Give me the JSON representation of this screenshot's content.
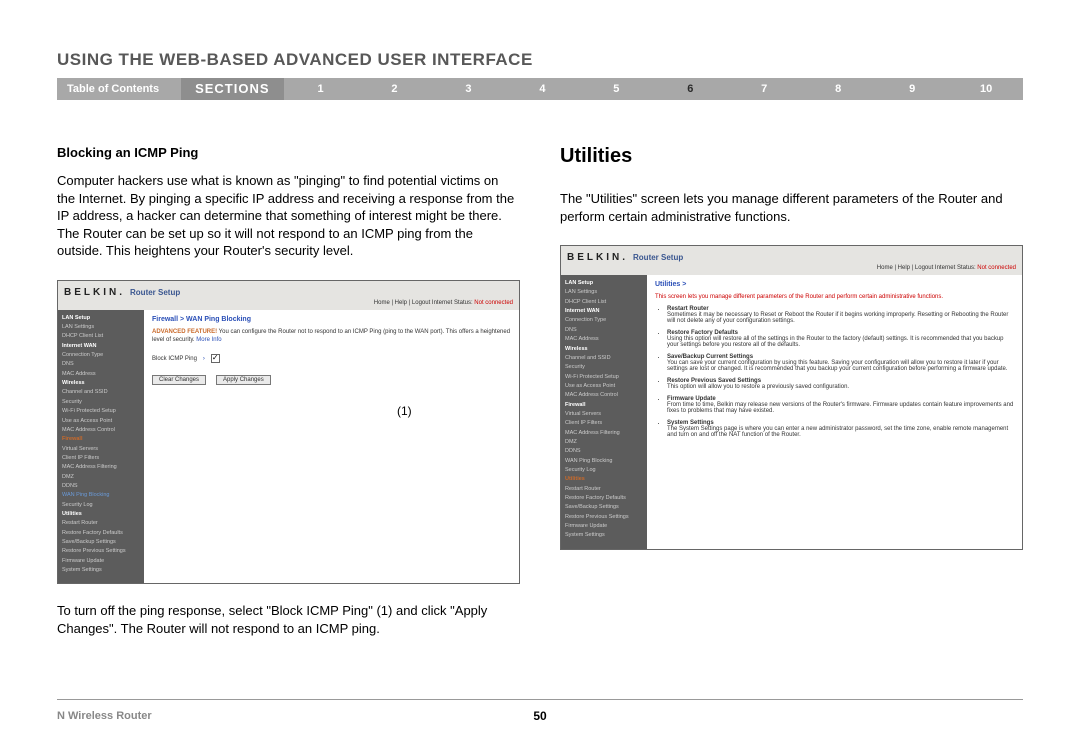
{
  "page": {
    "title": "USING THE WEB-BASED ADVANCED USER INTERFACE",
    "product": "N Wireless Router",
    "page_number": "50"
  },
  "nav": {
    "toc": "Table of Contents",
    "sections_label": "SECTIONS",
    "items": [
      "1",
      "2",
      "3",
      "4",
      "5",
      "6",
      "7",
      "8",
      "9",
      "10"
    ],
    "active": "6"
  },
  "left": {
    "heading": "Blocking an ICMP Ping",
    "para1": "Computer hackers use what is known as \"pinging\" to find potential victims on the Internet. By pinging a specific IP address and receiving a response from the IP address, a hacker can determine that something of interest might be there. The Router can be set up so it will not respond to an ICMP ping from the outside. This heightens your Router's security level.",
    "para2": "To turn off the ping response, select \"Block ICMP Ping\" (1) and click \"Apply Changes\". The Router will not respond to an ICMP ping.",
    "callout": "(1)"
  },
  "right": {
    "heading": "Utilities",
    "para1": "The \"Utilities\" screen lets you manage different parameters of the Router and perform certain administrative functions."
  },
  "shot_common": {
    "brand": "BELKIN",
    "setup": "Router Setup",
    "status_prefix": "Home | Help | Logout  Internet Status: ",
    "status_value": "Not connected"
  },
  "shot1": {
    "crumb": "Firewall > WAN Ping Blocking",
    "adv_bold": "ADVANCED FEATURE!",
    "adv_text": " You can configure the Router not to respond to an ICMP Ping (ping to the WAN port). This offers a heightened level of security. ",
    "more": "More Info",
    "block_label": "Block ICMP Ping",
    "btn_clear": "Clear Changes",
    "btn_apply": "Apply Changes",
    "side": {
      "g1": "LAN Setup",
      "i1": "LAN Settings",
      "i2": "DHCP Client List",
      "g2": "Internet WAN",
      "i3": "Connection Type",
      "i4": "DNS",
      "i5": "MAC Address",
      "g3": "Wireless",
      "i6": "Channel and SSID",
      "i7": "Security",
      "i8": "Wi-Fi Protected Setup",
      "i9": "Use as Access Point",
      "i10": "MAC Address Control",
      "g4": "Firewall",
      "i11": "Virtual Servers",
      "i12": "Client IP Filters",
      "i13": "MAC Address Filtering",
      "i14": "DMZ",
      "i15": "DDNS",
      "i16": "WAN Ping Blocking",
      "i17": "Security Log",
      "g5": "Utilities",
      "i18": "Restart Router",
      "i19": "Restore Factory Defaults",
      "i20": "Save/Backup Settings",
      "i21": "Restore Previous Settings",
      "i22": "Firmware Update",
      "i23": "System Settings"
    }
  },
  "shot2": {
    "crumb": "Utilities >",
    "intro": "This screen lets you manage different parameters of the Router and perform certain administrative functions.",
    "items": [
      {
        "t": "Restart Router",
        "d": "Sometimes it may be necessary to Reset or Reboot the Router if it begins working improperly. Resetting or Rebooting the Router will not delete any of your configuration settings."
      },
      {
        "t": "Restore Factory Defaults",
        "d": "Using this option will restore all of the settings in the Router to the factory (default) settings. It is recommended that you backup your settings before you restore all of the defaults."
      },
      {
        "t": "Save/Backup Current Settings",
        "d": "You can save your current configuration by using this feature. Saving your configuration will allow you to restore it later if your settings are lost or changed. It is recommended that you backup your current configuration before performing a firmware update."
      },
      {
        "t": "Restore Previous Saved Settings",
        "d": "This option will allow you to restore a previously saved configuration."
      },
      {
        "t": "Firmware Update",
        "d": "From time to time, Belkin may release new versions of the Router's firmware. Firmware updates contain feature improvements and fixes to problems that may have existed."
      },
      {
        "t": "System Settings",
        "d": "The System Settings page is where you can enter a new administrator password, set the time zone, enable remote management and turn on and off the NAT function of the Router."
      }
    ],
    "side": {
      "g1": "LAN Setup",
      "i1": "LAN Settings",
      "i2": "DHCP Client List",
      "g2": "Internet WAN",
      "i3": "Connection Type",
      "i4": "DNS",
      "i5": "MAC Address",
      "g3": "Wireless",
      "i6": "Channel and SSID",
      "i7": "Security",
      "i8": "Wi-Fi Protected Setup",
      "i9": "Use as Access Point",
      "i10": "MAC Address Control",
      "g4": "Firewall",
      "i11": "Virtual Servers",
      "i12": "Client IP Filters",
      "i13": "MAC Address Filtering",
      "i14": "DMZ",
      "i15": "DDNS",
      "i16": "WAN Ping Blocking",
      "i17": "Security Log",
      "g5": "Utilities",
      "i18": "Restart Router",
      "i19": "Restore Factory Defaults",
      "i20": "Save/Backup Settings",
      "i21": "Restore Previous Settings",
      "i22": "Firmware Update",
      "i23": "System Settings"
    }
  }
}
